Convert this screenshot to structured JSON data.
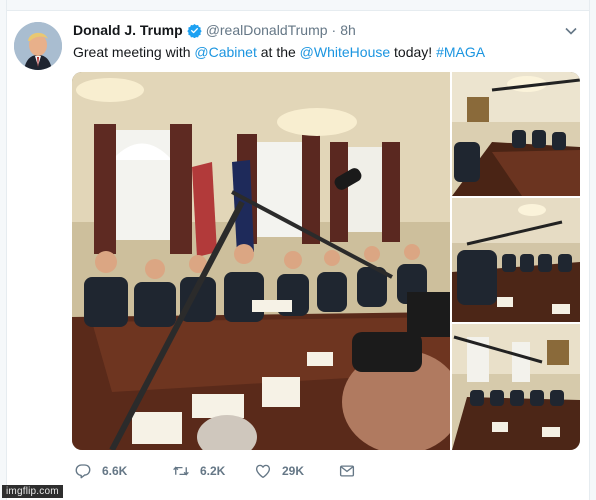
{
  "tweet": {
    "display_name": "Donald J. Trump",
    "handle": "@realDonaldTrump",
    "separator": "·",
    "timestamp": "8h",
    "text_parts": [
      "Great meeting with ",
      "@Cabinet",
      " at the ",
      "@WhiteHouse",
      " today! ",
      "#MAGA"
    ]
  },
  "icons": {
    "verified": "verified-badge-icon",
    "menu": "chevron-down-icon",
    "reply": "reply-icon",
    "retweet": "retweet-icon",
    "like": "heart-icon",
    "dm": "envelope-icon"
  },
  "actions": {
    "reply_count": "6.6K",
    "retweet_count": "6.2K",
    "like_count": "29K"
  },
  "colors": {
    "link": "#1b95e0",
    "verified": "#1da1f2",
    "secondary_text": "#657786"
  },
  "watermark": "imgflip.com"
}
